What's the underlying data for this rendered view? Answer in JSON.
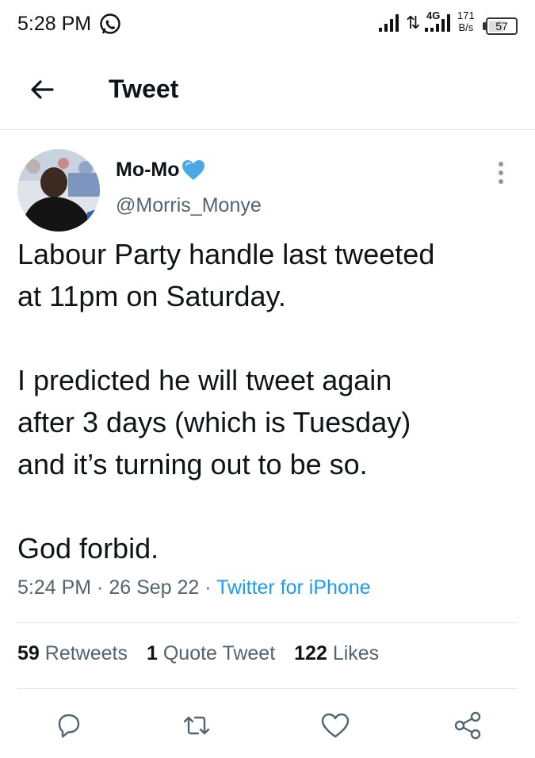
{
  "status_bar": {
    "time": "5:28 PM",
    "network_type": "4G",
    "net_speed_value": "171",
    "net_speed_unit": "B/s",
    "battery": "57",
    "battery_level": 0.57
  },
  "header": {
    "back_icon": "arrow-left-icon",
    "title": "Tweet"
  },
  "tweet": {
    "author": {
      "display_name": "Mo-Mo",
      "badge_icon": "blue-heart-icon",
      "handle": "@Morris_Monye"
    },
    "paragraphs": [
      [
        "Labour Party handle last tweeted",
        "at 11pm on Saturday."
      ],
      [
        "I predicted he will tweet again",
        "after 3 days (which is Tuesday)",
        "and it’s turning out to be so."
      ],
      [
        "God forbid."
      ]
    ],
    "time": "5:24 PM",
    "date": "26 Sep 22",
    "separator": "·",
    "source": "Twitter for iPhone"
  },
  "stats": {
    "retweets_count": "59",
    "retweets_label": "Retweets",
    "quotes_count": "1",
    "quotes_label": "Quote Tweet",
    "likes_count": "122",
    "likes_label": "Likes"
  },
  "actions": [
    "reply-icon",
    "retweet-icon",
    "like-icon",
    "share-icon"
  ],
  "colors": {
    "text": "#0f1419",
    "secondary": "#536471",
    "accent": "#1d9bf0",
    "divider": "#e5e5e5"
  }
}
